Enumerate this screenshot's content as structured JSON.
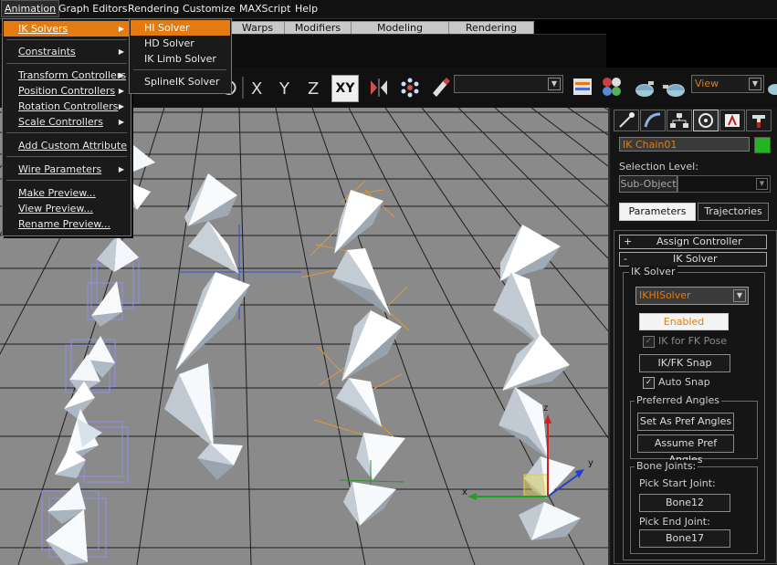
{
  "menubar": {
    "items": [
      "Animation",
      "Graph Editors",
      "Rendering",
      "Customize",
      "MAXScript",
      "Help"
    ]
  },
  "tabs": [
    "Warps",
    "Modifiers",
    "Modeling",
    "Rendering"
  ],
  "toolbar": {
    "axis_x": "X",
    "axis_y": "Y",
    "axis_z": "Z",
    "axis_xy": "XY",
    "view_dropdown": "View"
  },
  "animation_menu": {
    "items": [
      {
        "label": "IK Solvers",
        "submenu": true,
        "highlighted": true
      },
      {
        "label": "Constraints",
        "submenu": true
      },
      {
        "label": "Transform Controllers",
        "submenu": true
      },
      {
        "label": "Position Controllers",
        "submenu": true
      },
      {
        "label": "Rotation Controllers",
        "submenu": true
      },
      {
        "label": "Scale Controllers",
        "submenu": true
      },
      {
        "label": "Add Custom Attribute",
        "submenu": false
      },
      {
        "label": "Wire Parameters",
        "submenu": true
      },
      {
        "label": "Make Preview...",
        "submenu": false
      },
      {
        "label": "View Preview...",
        "submenu": false
      },
      {
        "label": "Rename Preview...",
        "submenu": false
      }
    ]
  },
  "ik_submenu": {
    "items": [
      {
        "label": "HI Solver",
        "highlighted": true
      },
      {
        "label": "HD Solver"
      },
      {
        "label": "IK Limb Solver"
      },
      {
        "label": "SplineIK Solver"
      }
    ]
  },
  "command_panel": {
    "object_name": "IK Chain01",
    "object_color": "#22b522",
    "selection_level_label": "Selection Level:",
    "sub_object": "Sub-Object",
    "tab_parameters": "Parameters",
    "tab_trajectories": "Trajectories",
    "rollout_assign": {
      "toggle": "+",
      "label": "Assign Controller"
    },
    "rollout_ik": {
      "toggle": "-",
      "label": "IK Solver"
    },
    "ik_group_title": "IK Solver",
    "solver_select": "IKHISolver",
    "enabled_button": "Enabled",
    "ik_for_fk_pose": "IK for FK Pose",
    "ik_fk_snap": "IK/FK Snap",
    "auto_snap": "Auto Snap",
    "preferred_angles_title": "Preferred Angles",
    "set_as_pref_angles": "Set As Pref Angles",
    "assume_pref_angles": "Assume Pref Angles",
    "bone_joints_title": "Bone Joints:",
    "pick_start_joint": "Pick Start Joint:",
    "start_joint": "Bone12",
    "pick_end_joint": "Pick End Joint:",
    "end_joint": "Bone17"
  },
  "colors": {
    "accent": "#e37b10",
    "viewport_bg": "#8a8a8a",
    "panel_bg": "#151515"
  }
}
